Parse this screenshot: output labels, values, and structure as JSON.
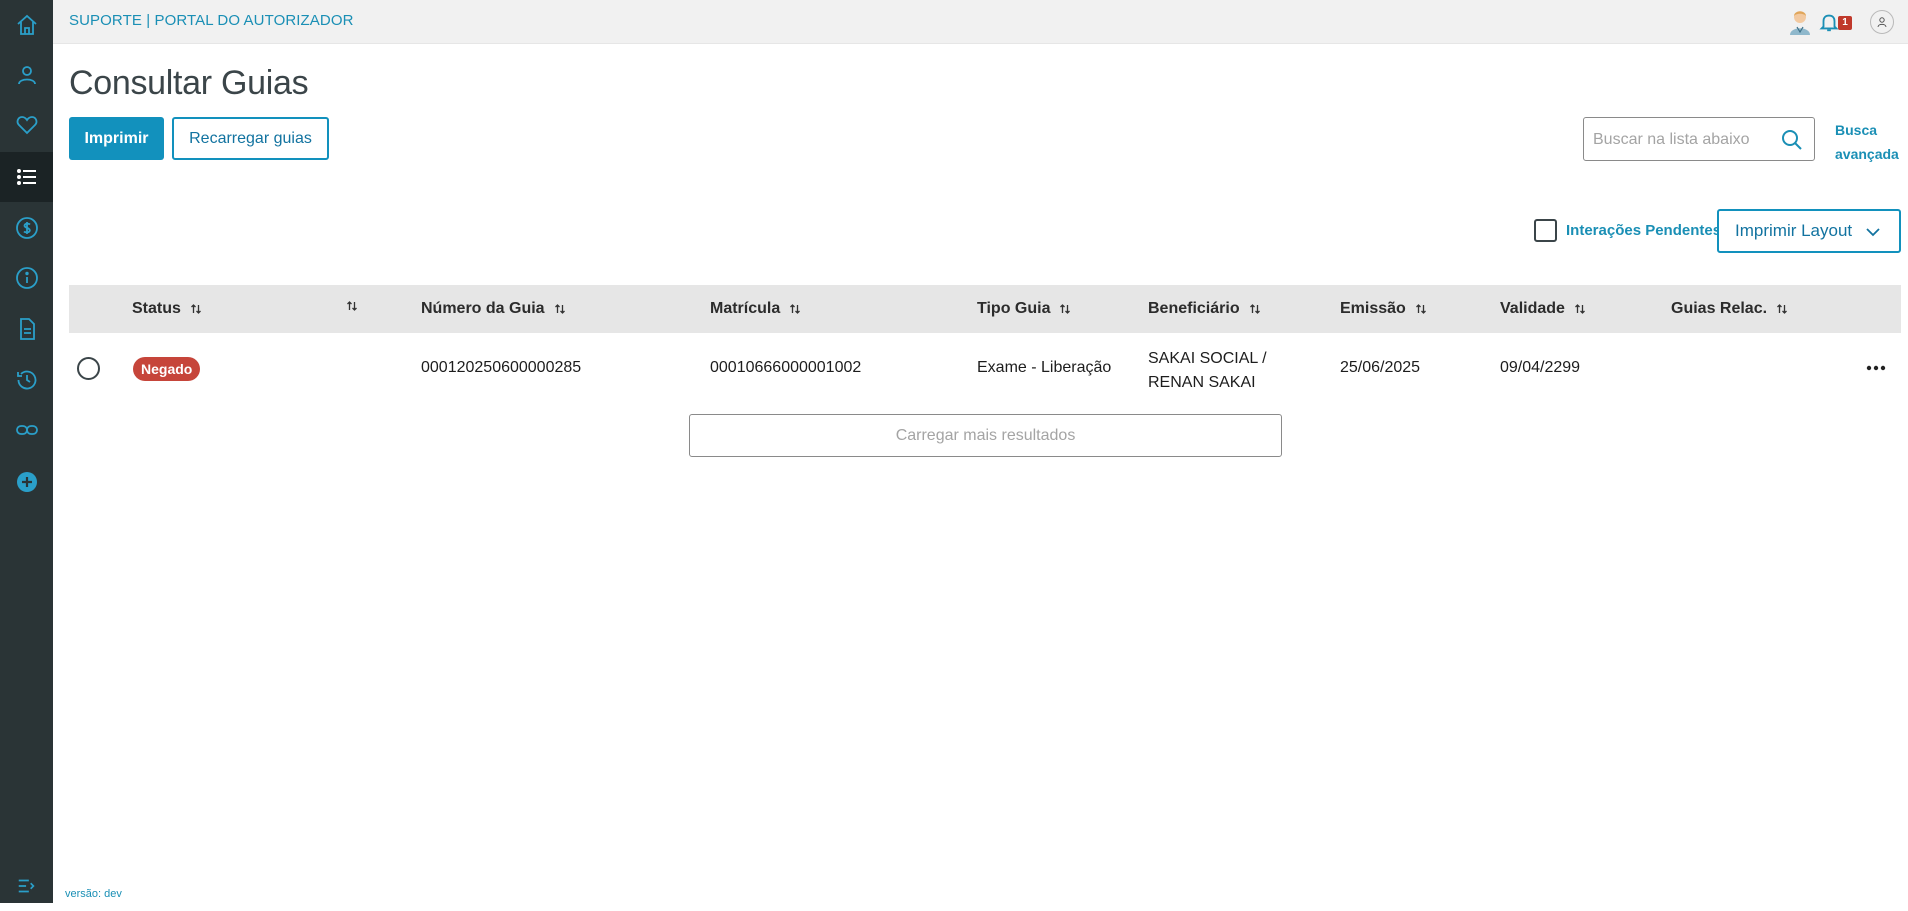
{
  "header": {
    "title": "SUPORTE | PORTAL DO AUTORIZADOR",
    "notification_count": "1"
  },
  "sidebar": {
    "items": [
      {
        "icon": "home-icon"
      },
      {
        "icon": "user-icon"
      },
      {
        "icon": "heart-icon"
      },
      {
        "icon": "list-icon",
        "active": true
      },
      {
        "icon": "dollar-icon"
      },
      {
        "icon": "info-icon"
      },
      {
        "icon": "document-icon"
      },
      {
        "icon": "history-icon"
      },
      {
        "icon": "link-icon"
      },
      {
        "icon": "add-icon"
      }
    ],
    "collapse_icon": "collapse-menu-icon"
  },
  "page": {
    "title": "Consultar Guias",
    "print_label": "Imprimir",
    "reload_label": "Recarregar guias",
    "search_placeholder": "Buscar na lista abaixo",
    "advanced_search_label": "Busca avançada",
    "pending_label": "Interações Pendentes",
    "print_layout_label": "Imprimir Layout"
  },
  "table": {
    "columns": [
      "Status",
      "",
      "Número da Guia",
      "Matrícula",
      "Tipo Guia",
      "Beneficiário",
      "Emissão",
      "Validade",
      "Guias Relac."
    ],
    "rows": [
      {
        "status": "Negado",
        "numero": "000120250600000285",
        "matricula": "00010666000001002",
        "tipo": "Exame - Liberação",
        "beneficiario": "SAKAI SOCIAL / RENAN SAKAI",
        "emissao": "25/06/2025",
        "validade": "09/04/2299",
        "guias_relac": ""
      }
    ],
    "load_more_label": "Carregar mais resultados"
  },
  "footer": {
    "version": "versão: dev"
  },
  "colors": {
    "accent": "#1291bd",
    "sidebar": "#2a3436",
    "status_denied": "#c6453a"
  }
}
